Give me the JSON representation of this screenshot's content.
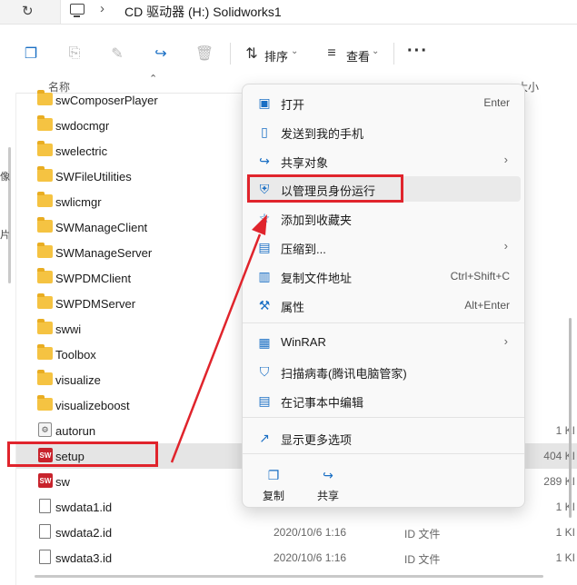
{
  "address": {
    "path": "CD 驱动器 (H:) Solidworks1"
  },
  "toolbar": {
    "sort_label": "排序",
    "view_label": "查看"
  },
  "header": {
    "name": "名称",
    "size": "大小"
  },
  "left_strip": [
    "像",
    "片"
  ],
  "files": [
    {
      "name": "swComposerPlayer",
      "icon": "folder",
      "date": "",
      "type": "",
      "size": ""
    },
    {
      "name": "swdocmgr",
      "icon": "folder",
      "date": "",
      "type": "",
      "size": ""
    },
    {
      "name": "swelectric",
      "icon": "folder",
      "date": "",
      "type": "",
      "size": ""
    },
    {
      "name": "SWFileUtilities",
      "icon": "folder",
      "date": "",
      "type": "",
      "size": ""
    },
    {
      "name": "swlicmgr",
      "icon": "folder",
      "date": "",
      "type": "",
      "size": ""
    },
    {
      "name": "SWManageClient",
      "icon": "folder",
      "date": "",
      "type": "",
      "size": ""
    },
    {
      "name": "SWManageServer",
      "icon": "folder",
      "date": "",
      "type": "",
      "size": ""
    },
    {
      "name": "SWPDMClient",
      "icon": "folder",
      "date": "",
      "type": "",
      "size": ""
    },
    {
      "name": "SWPDMServer",
      "icon": "folder",
      "date": "",
      "type": "",
      "size": ""
    },
    {
      "name": "swwi",
      "icon": "folder",
      "date": "",
      "type": "",
      "size": ""
    },
    {
      "name": "Toolbox",
      "icon": "folder",
      "date": "",
      "type": "",
      "size": ""
    },
    {
      "name": "visualize",
      "icon": "folder",
      "date": "",
      "type": "",
      "size": ""
    },
    {
      "name": "visualizeboost",
      "icon": "folder",
      "date": "",
      "type": "",
      "size": ""
    },
    {
      "name": "autorun",
      "icon": "config",
      "date": "",
      "type": "",
      "size": "1 KI"
    },
    {
      "name": "setup",
      "icon": "sw",
      "date": "",
      "type": "",
      "size": "404 KI"
    },
    {
      "name": "sw",
      "icon": "sw",
      "date": "",
      "type": "",
      "size": "289 KI"
    },
    {
      "name": "swdata1.id",
      "icon": "doc",
      "date": "",
      "type": "",
      "size": "1 KI"
    },
    {
      "name": "swdata2.id",
      "icon": "doc",
      "date": "2020/10/6 1:16",
      "type": "ID 文件",
      "size": "1 KI"
    },
    {
      "name": "swdata3.id",
      "icon": "doc",
      "date": "2020/10/6 1:16",
      "type": "ID 文件",
      "size": "1 KI"
    }
  ],
  "context_menu": {
    "items": [
      {
        "label": "打开",
        "shortcut": "Enter",
        "icon": "open-icon"
      },
      {
        "label": "发送到我的手机",
        "shortcut": "",
        "icon": "phone-icon"
      },
      {
        "label": "共享对象",
        "shortcut": "",
        "icon": "share-icon",
        "submenu": true
      },
      {
        "label": "以管理员身份运行",
        "shortcut": "",
        "icon": "shield-icon"
      },
      {
        "label": "添加到收藏夹",
        "shortcut": "",
        "icon": "star-icon"
      },
      {
        "label": "压缩到...",
        "shortcut": "",
        "icon": "zip-icon",
        "submenu": true
      },
      {
        "label": "复制文件地址",
        "shortcut": "Ctrl+Shift+C",
        "icon": "path-icon"
      },
      {
        "label": "属性",
        "shortcut": "Alt+Enter",
        "icon": "wrench-icon"
      },
      {
        "label": "WinRAR",
        "shortcut": "",
        "icon": "winrar-icon",
        "submenu": true
      },
      {
        "label": "扫描病毒(腾讯电脑管家)",
        "shortcut": "",
        "icon": "antivirus-icon"
      },
      {
        "label": "在记事本中编辑",
        "shortcut": "",
        "icon": "notepad-icon"
      },
      {
        "label": "显示更多选项",
        "shortcut": "",
        "icon": "more-options-icon"
      }
    ],
    "bottom_buttons": [
      {
        "label": "复制",
        "icon": "copy-icon"
      },
      {
        "label": "共享",
        "icon": "share-icon"
      }
    ]
  },
  "colors": {
    "highlight_box": "#e0242c",
    "accent": "#1a6fc4"
  }
}
